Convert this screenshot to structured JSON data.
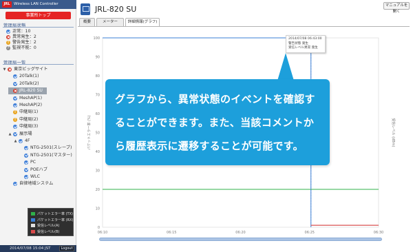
{
  "sidebar": {
    "brand": {
      "logo": "JRL",
      "title": "Wireless LAN Controller"
    },
    "alarm_button": "事業所トップ",
    "status_section": {
      "title": "管理局状態",
      "rows": [
        {
          "icon": "ok",
          "text": "正常：10"
        },
        {
          "icon": "err",
          "text": "異常発生：2"
        },
        {
          "icon": "warn",
          "text": "警告発生：2"
        },
        {
          "icon": "unk",
          "text": "監視不能：0"
        }
      ]
    },
    "tree_section": {
      "title": "管理局一覧",
      "nodes": [
        {
          "indent": 0,
          "toggle": "▼",
          "icon": "err",
          "label": "東京ビッグサイト",
          "selected": false
        },
        {
          "indent": 1,
          "toggle": "",
          "icon": "ok",
          "label": "20Talk(1)",
          "selected": false
        },
        {
          "indent": 1,
          "toggle": "",
          "icon": "ok",
          "label": "20Talk(2)",
          "selected": false
        },
        {
          "indent": 1,
          "toggle": "",
          "icon": "err",
          "label": "JRL-820 SU",
          "selected": true
        },
        {
          "indent": 1,
          "toggle": "",
          "icon": "ok",
          "label": "MeshAP(1)",
          "selected": false
        },
        {
          "indent": 1,
          "toggle": "",
          "icon": "ok",
          "label": "MeshAP(2)",
          "selected": false
        },
        {
          "indent": 1,
          "toggle": "",
          "icon": "warn",
          "label": "中継局(1)",
          "selected": false
        },
        {
          "indent": 1,
          "toggle": "",
          "icon": "warn",
          "label": "中継局(2)",
          "selected": false
        },
        {
          "indent": 1,
          "toggle": "",
          "icon": "ok",
          "label": "中継局(3)",
          "selected": false
        },
        {
          "indent": 1,
          "toggle": "▲",
          "icon": "ok",
          "label": "展示場",
          "selected": false
        },
        {
          "indent": 2,
          "toggle": "▲",
          "icon": "ok",
          "label": "4F",
          "selected": false
        },
        {
          "indent": 3,
          "toggle": "",
          "icon": "ok",
          "label": "NTG-2501(スレーブ)",
          "selected": false
        },
        {
          "indent": 3,
          "toggle": "",
          "icon": "ok",
          "label": "NTG-2501(マスター)",
          "selected": false
        },
        {
          "indent": 3,
          "toggle": "",
          "icon": "ok",
          "label": "PC",
          "selected": false
        },
        {
          "indent": 3,
          "toggle": "",
          "icon": "ok",
          "label": "POEハブ",
          "selected": false
        },
        {
          "indent": 3,
          "toggle": "",
          "icon": "ok",
          "label": "WLC",
          "selected": false
        },
        {
          "indent": 1,
          "toggle": "",
          "icon": "ok",
          "label": "自律地域システム",
          "selected": false
        }
      ]
    },
    "legend": [
      {
        "color": "#2fb04a",
        "label": "パケットエラー率 (TX)"
      },
      {
        "color": "#3a7fd6",
        "label": "パケットエラー率 (RX)"
      },
      {
        "color": "#e0e0e0",
        "label": "受信レベル(A)"
      },
      {
        "color": "#d94a4a",
        "label": "受信レベル(B)"
      }
    ],
    "status_bar": {
      "time": "2014/07/08 15:04 JST",
      "logout": "Logout"
    }
  },
  "main": {
    "device_title": "JRL-820 SU",
    "manual_button": "マニュアルを開く",
    "tabs": [
      {
        "label": "概要",
        "active": false
      },
      {
        "label": "メーター",
        "active": false
      },
      {
        "label": "詳細情報(グラフ)",
        "active": true
      }
    ],
    "event_popup": {
      "lines": [
        "2014/07/08 06:43:00",
        "警告状態 発生",
        "受信レベル異常 発生"
      ]
    }
  },
  "callout": {
    "text": "グラフから、異常状態のイベントを確認することができます。また、当該コメントから履歴表示に遷移することが可能です。"
  },
  "chart_data": {
    "type": "line",
    "title": "",
    "xlabel": "",
    "ylabel": "パケットエラー率 (%)",
    "y2label": "受信レベル (dBm)",
    "ylim": [
      0,
      100
    ],
    "x_tick_labels": [
      "06:10",
      "06:15",
      "06:20",
      "06:25",
      "06:30"
    ],
    "y_tick_labels": [
      "0",
      "10",
      "20",
      "30",
      "40",
      "50",
      "60",
      "70",
      "80",
      "90",
      "100"
    ],
    "event_marker_time": "06:43",
    "grid": false,
    "series": [
      {
        "name": "パケットエラー率 (TX)",
        "color": "#2fb04a",
        "x": [
          "06:10",
          "06:25",
          "06:30"
        ],
        "values": [
          20,
          20,
          20
        ]
      },
      {
        "name": "パケットエラー率 (RX)",
        "color": "#3a7fd6",
        "x": [
          "06:10",
          "06:25",
          "06:30"
        ],
        "values": [
          100,
          100,
          0
        ]
      },
      {
        "name": "受信レベル(B)",
        "color": "#d94a4a",
        "x": [
          "06:25",
          "06:30"
        ],
        "values": [
          1,
          1
        ]
      }
    ]
  }
}
